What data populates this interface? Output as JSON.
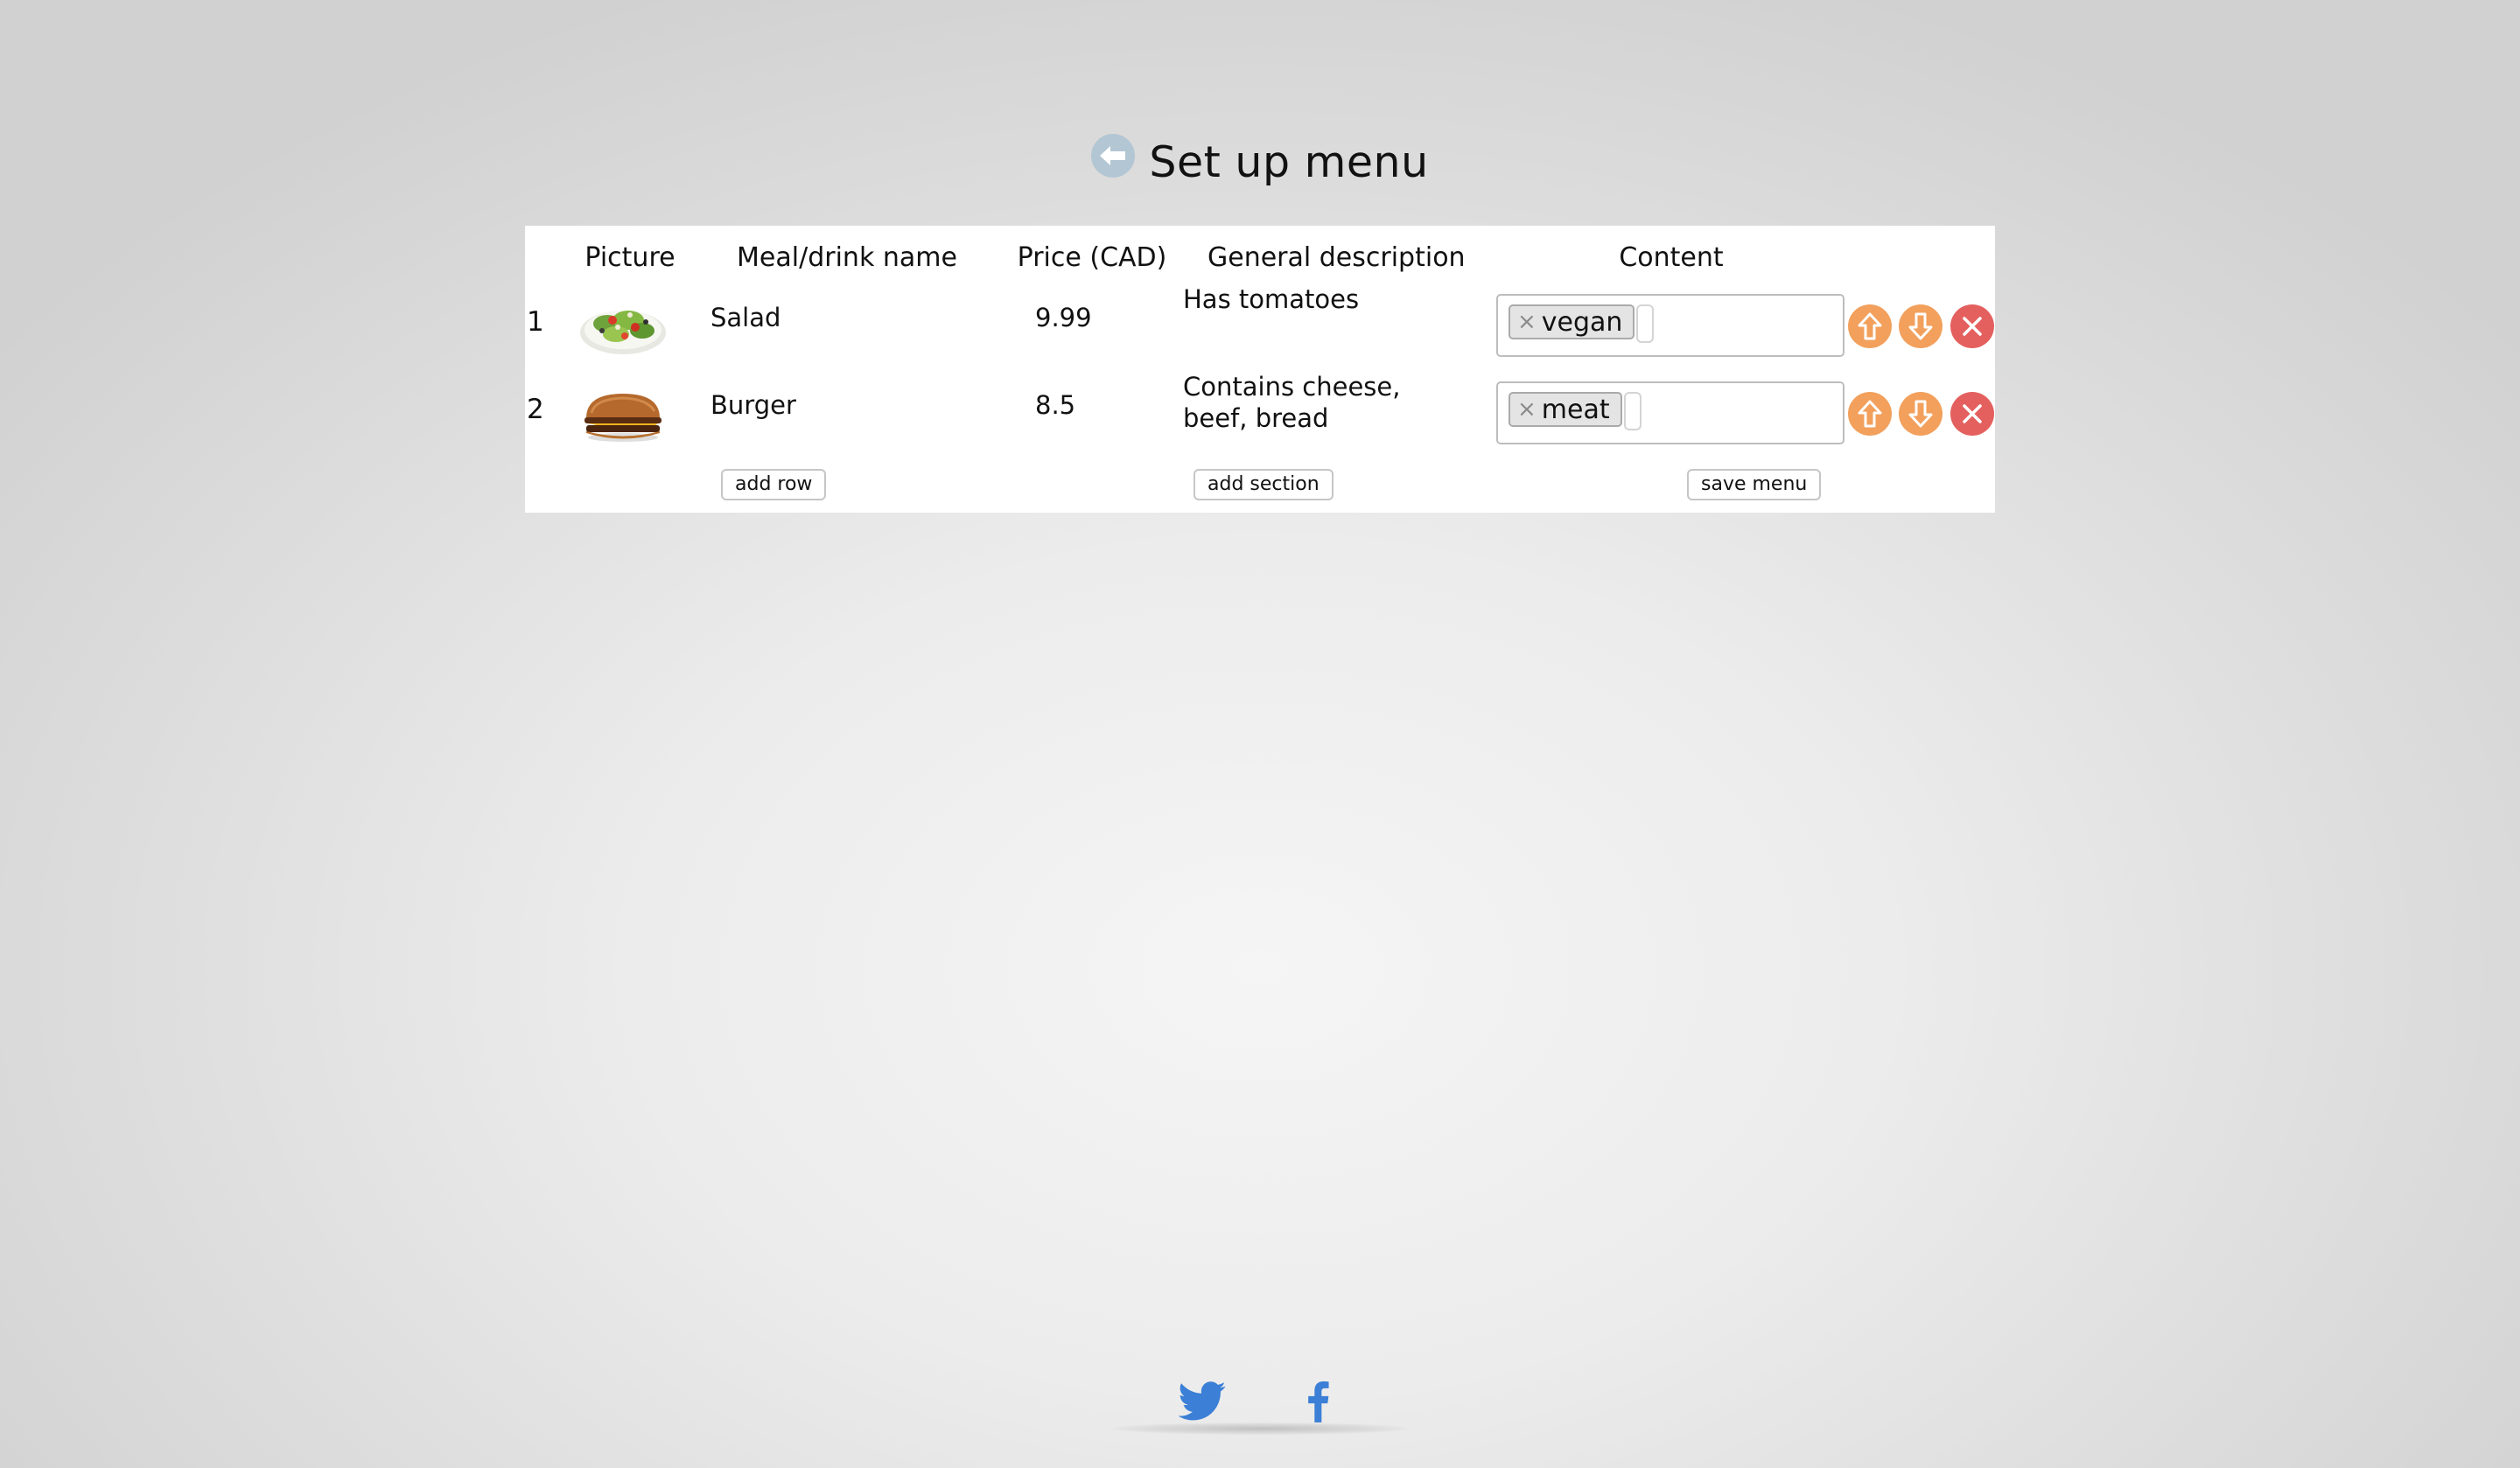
{
  "page": {
    "title": "Set up menu"
  },
  "table": {
    "headers": {
      "picture": "Picture",
      "name": "Meal/drink name",
      "price": "Price (CAD)",
      "description": "General description",
      "content": "Content"
    },
    "rows": [
      {
        "number": "1",
        "picture_icon": "salad-image",
        "name": "Salad",
        "price": "9.99",
        "description": "Has tomatoes",
        "tags": [
          "vegan"
        ]
      },
      {
        "number": "2",
        "picture_icon": "burger-image",
        "name": "Burger",
        "price": "8.5",
        "description": "Contains cheese, beef, bread",
        "tags": [
          "meat"
        ]
      }
    ]
  },
  "actions": {
    "add_row": "add row",
    "add_section": "add section",
    "save_menu": "save menu"
  },
  "icons": {
    "back": "back-arrow-icon",
    "move_up": "arrow-up-icon",
    "move_down": "arrow-down-icon",
    "delete": "close-icon",
    "tag_remove": "×"
  },
  "footer": {
    "social": [
      "twitter-icon",
      "facebook-icon"
    ]
  },
  "colors": {
    "back_button": "#b3c6d4",
    "move_buttons": "#f2a05c",
    "delete_button": "#e4605e",
    "social_blue": "#3b7fd6"
  }
}
